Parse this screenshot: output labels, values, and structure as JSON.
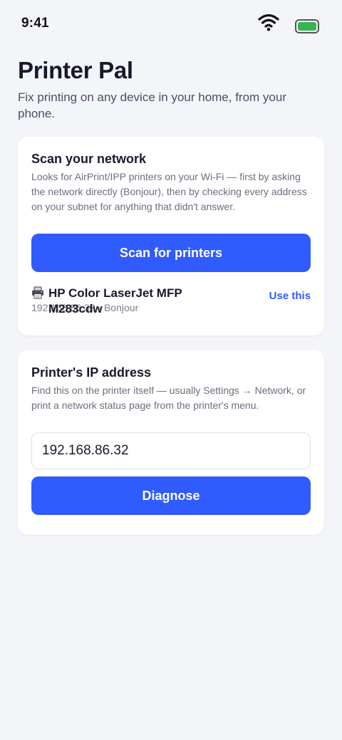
{
  "status_bar": {
    "time": "9:41",
    "icons": [
      "wifi-icon",
      "battery-icon"
    ],
    "battery_color": "#34b552"
  },
  "header": {
    "title": "Printer Pal",
    "subtitle": "Fix printing on any device in your home, from your phone."
  },
  "scan_card": {
    "title": "Scan your network",
    "description": "Looks for AirPrint/IPP printers on your Wi-Fi — first by asking the network directly (Bonjour), then by checking every address on your subnet for anything that didn't answer.",
    "button_label": "Scan for printers",
    "results": [
      {
        "icon": "printer-icon",
        "name": "HP Color LaserJet MFP M283cdw",
        "meta": "192.168.86.32 · Bonjour",
        "action_label": "Use this"
      }
    ]
  },
  "ip_card": {
    "title": "Printer's IP address",
    "description": "Find this on the printer itself — usually Settings → Network, or print a network status page from the printer's menu.",
    "input_value": "192.168.86.32",
    "button_label": "Diagnose"
  },
  "colors": {
    "accent": "#2f5bff",
    "background": "#f4f5f9",
    "card": "#ffffff",
    "text_primary": "#171a2b",
    "text_secondary": "#6b6f7d"
  }
}
